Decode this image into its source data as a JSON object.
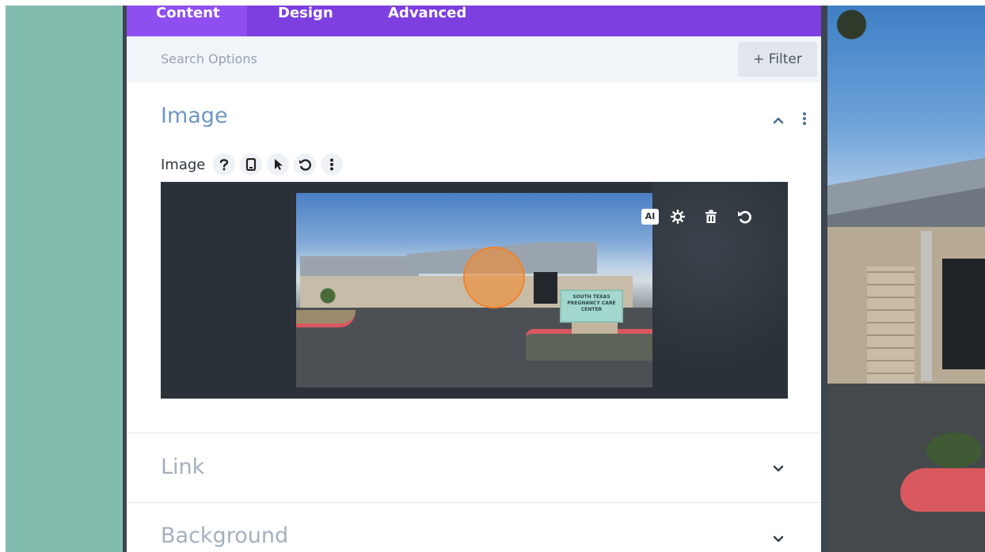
{
  "tabs": {
    "content": "Content",
    "design": "Design",
    "advanced": "Advanced"
  },
  "search": {
    "placeholder": "Search Options"
  },
  "filter": {
    "label": "+ Filter"
  },
  "sections": {
    "image": {
      "title": "Image",
      "option_label": "Image",
      "ai_label": "AI",
      "preview_sign_text": "SOUTH TEXAS PREGNANCY CARE CENTER"
    },
    "link": {
      "title": "Link"
    },
    "background": {
      "title": "Background"
    }
  },
  "colors": {
    "tab_bar": "#7d3fe0",
    "tab_active": "#8f4ef0",
    "section_title_open": "#6f97c3",
    "section_title_closed": "#a3b0be",
    "left_strip": "#82bcaf",
    "focus_marker": "#f28c32"
  },
  "icons": {
    "option_icons": [
      "help-icon",
      "mobile-icon",
      "cursor-icon",
      "reset-icon",
      "more-vertical-icon"
    ],
    "image_actions": [
      "ai-icon",
      "gear-icon",
      "trash-icon",
      "undo-icon"
    ]
  }
}
